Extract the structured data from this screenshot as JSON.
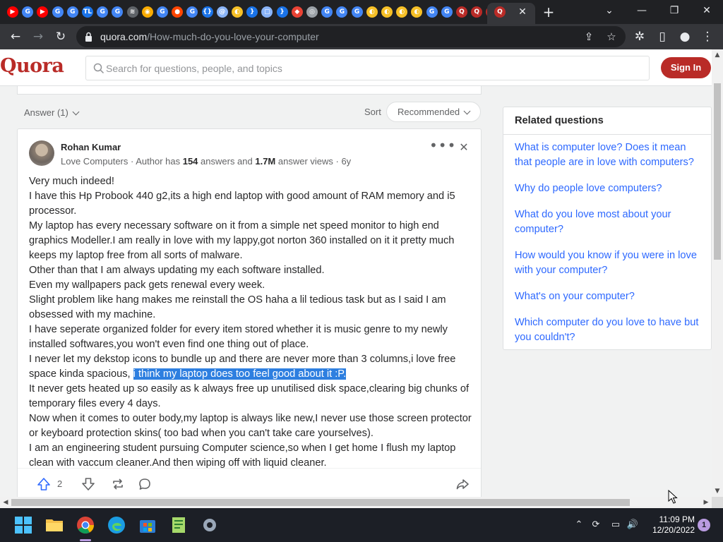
{
  "browser": {
    "tab_favicons": [
      {
        "name": "youtube-icon",
        "glyph": "▶",
        "color": "#ff0000"
      },
      {
        "name": "google-icon",
        "glyph": "G",
        "color": "#4285f4"
      },
      {
        "name": "youtube-icon",
        "glyph": "▶",
        "color": "#ff0000"
      },
      {
        "name": "google-icon",
        "glyph": "G",
        "color": "#4285f4"
      },
      {
        "name": "google-icon",
        "glyph": "G",
        "color": "#4285f4"
      },
      {
        "name": "tl-icon",
        "glyph": "TL",
        "color": "#1a73e8"
      },
      {
        "name": "google-icon",
        "glyph": "G",
        "color": "#4285f4"
      },
      {
        "name": "google-icon",
        "glyph": "G",
        "color": "#4285f4"
      },
      {
        "name": "wifi-icon",
        "glyph": "≋",
        "color": "#5f6368"
      },
      {
        "name": "speedtest-icon",
        "glyph": "◉",
        "color": "#f9ab00"
      },
      {
        "name": "google-icon",
        "glyph": "G",
        "color": "#4285f4"
      },
      {
        "name": "reddit-icon",
        "glyph": "●",
        "color": "#ff4500"
      },
      {
        "name": "google-icon",
        "glyph": "G",
        "color": "#4285f4"
      },
      {
        "name": "code-icon",
        "glyph": "{}",
        "color": "#1a73e8"
      },
      {
        "name": "at-icon",
        "glyph": "@",
        "color": "#8ab4f8"
      },
      {
        "name": "doc-icon",
        "glyph": "◐",
        "color": "#f6c026"
      },
      {
        "name": "code-icon",
        "glyph": "}",
        "color": "#1a73e8"
      },
      {
        "name": "chat-icon",
        "glyph": "▢",
        "color": "#8ab4f8"
      },
      {
        "name": "code-icon",
        "glyph": "}",
        "color": "#1a73e8"
      },
      {
        "name": "photo-icon",
        "glyph": "◆",
        "color": "#ea4335"
      },
      {
        "name": "chrome-icon",
        "glyph": "◎",
        "color": "#9aa0a6"
      },
      {
        "name": "google-icon",
        "glyph": "G",
        "color": "#4285f4"
      },
      {
        "name": "google-icon",
        "glyph": "G",
        "color": "#4285f4"
      },
      {
        "name": "google-icon",
        "glyph": "G",
        "color": "#4285f4"
      },
      {
        "name": "doc-icon",
        "glyph": "◐",
        "color": "#f6c026"
      },
      {
        "name": "doc-icon",
        "glyph": "◐",
        "color": "#f6c026"
      },
      {
        "name": "doc-icon",
        "glyph": "◐",
        "color": "#f6c026"
      },
      {
        "name": "doc-icon",
        "glyph": "◐",
        "color": "#f6c026"
      },
      {
        "name": "google-icon",
        "glyph": "G",
        "color": "#4285f4"
      },
      {
        "name": "google-icon",
        "glyph": "G",
        "color": "#4285f4"
      },
      {
        "name": "quora-icon",
        "glyph": "Q",
        "color": "#b92b27"
      },
      {
        "name": "quora-icon",
        "glyph": "Q",
        "color": "#b92b27"
      },
      {
        "name": "quora-icon",
        "glyph": "Q",
        "color": "#b92b27"
      }
    ],
    "active_tab_favicon": {
      "name": "quora-icon",
      "glyph": "Q",
      "color": "#b92b27"
    },
    "url_host": "quora.com",
    "url_path": "/How-much-do-you-love-your-computer"
  },
  "quora": {
    "logo": "Quora",
    "search_placeholder": "Search for questions, people, and topics",
    "signin_label": "Sign In",
    "brand_color": "#b92b27"
  },
  "answers": {
    "filter_label": "Answer (1)",
    "sort_label": "Sort",
    "sort_value": "Recommended"
  },
  "answer": {
    "author_name": "Rohan Kumar",
    "author_meta": {
      "topic": "Love Computers",
      "author_prefix": " · Author has ",
      "answer_count": "154",
      "answers_word": " answers and ",
      "view_count": "1.7M",
      "views_suffix": " answer views · 6y"
    },
    "lines": [
      "Very much indeed!",
      "I have this Hp Probook 440 g2,its a high end laptop with good amount of RAM memory and i5 processor.",
      "My laptop has every necessary software on it from a simple net speed monitor to high end graphics Modeller.I am really in love with my lappy,got norton 360 installed on it it pretty much keeps my laptop free from all sorts of malware.",
      "Other than that I am always updating my each software installed.",
      "Even my wallpapers pack gets renewal every week.",
      "Slight problem like hang makes me reinstall the OS haha a lil tedious task but as I said I am obsessed with my machine.",
      "I have seperate organized folder for every item stored whether it is music genre to my newly installed softwares,you won't even find one thing out of place."
    ],
    "line_with_highlight": {
      "before": "I never let my dekstop icons to bundle up and there are never more than 3 columns,i love free space kinda spacious, ",
      "highlighted": "i think my laptop does too feel good about it :P."
    },
    "lines_after": [
      "It never gets heated up so easily as k always free up unutilised disk space,clearing big chunks of temporary files every 4 days.",
      "Now when it comes to outer body,my laptop is always like new,I never use those screen protector or keyboard protection skins( too bad when you can't take care yourselves).",
      "I am an engineering student pursuing Computer science,so when I get home I flush my laptop clean with vaccum cleaner.And then wiping off with liquid cleaner."
    ],
    "upvote_count": "2"
  },
  "related": {
    "title": "Related questions",
    "questions": [
      "What is computer love? Does it mean that people are in love with computers?",
      "Why do people love computers?",
      "What do you love most about your computer?",
      "How would you know if you were in love with your computer?",
      "What's on your computer?",
      "Which computer do you love to have but you couldn't?"
    ]
  },
  "taskbar": {
    "time": "11:09 PM",
    "date": "12/20/2022",
    "notification_count": "1"
  }
}
